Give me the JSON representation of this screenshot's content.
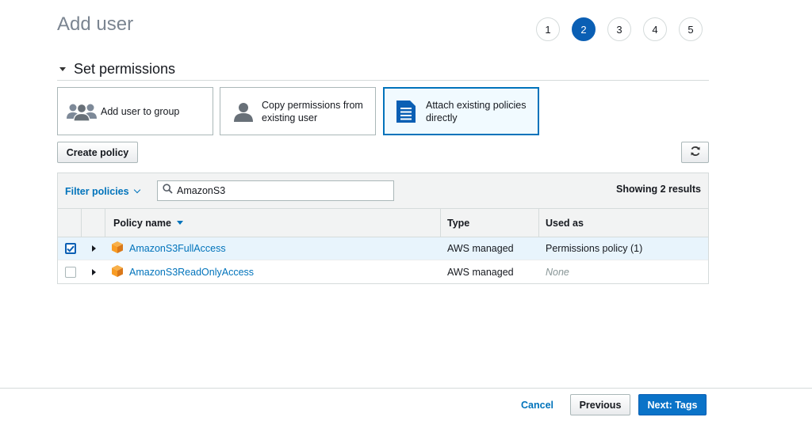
{
  "header": {
    "title": "Add user"
  },
  "steps": [
    {
      "label": "1",
      "active": false
    },
    {
      "label": "2",
      "active": true
    },
    {
      "label": "3",
      "active": false
    },
    {
      "label": "4",
      "active": false
    },
    {
      "label": "5",
      "active": false
    }
  ],
  "section": {
    "title": "Set permissions"
  },
  "options": [
    {
      "label": "Add user to group",
      "icon": "group-icon",
      "selected": false
    },
    {
      "label": "Copy permissions from existing user",
      "icon": "user-icon",
      "selected": false
    },
    {
      "label": "Attach existing policies directly",
      "icon": "document-icon",
      "selected": true
    }
  ],
  "toolbar": {
    "create_policy_label": "Create policy",
    "refresh_icon": "refresh-icon"
  },
  "filter": {
    "label": "Filter policies",
    "search_value": "AmazonS3",
    "showing": "Showing 2 results"
  },
  "table": {
    "columns": {
      "name": "Policy name",
      "type": "Type",
      "used_as": "Used as"
    },
    "rows": [
      {
        "name": "AmazonS3FullAccess",
        "type": "AWS managed",
        "used_as": "Permissions policy (1)",
        "checked": true
      },
      {
        "name": "AmazonS3ReadOnlyAccess",
        "type": "AWS managed",
        "used_as": "None",
        "checked": false
      }
    ]
  },
  "footer": {
    "cancel_label": "Cancel",
    "previous_label": "Previous",
    "next_label": "Next: Tags"
  },
  "colors": {
    "accent": "#0a5fb4",
    "link": "#0073bb",
    "orange": "#f89c24"
  }
}
